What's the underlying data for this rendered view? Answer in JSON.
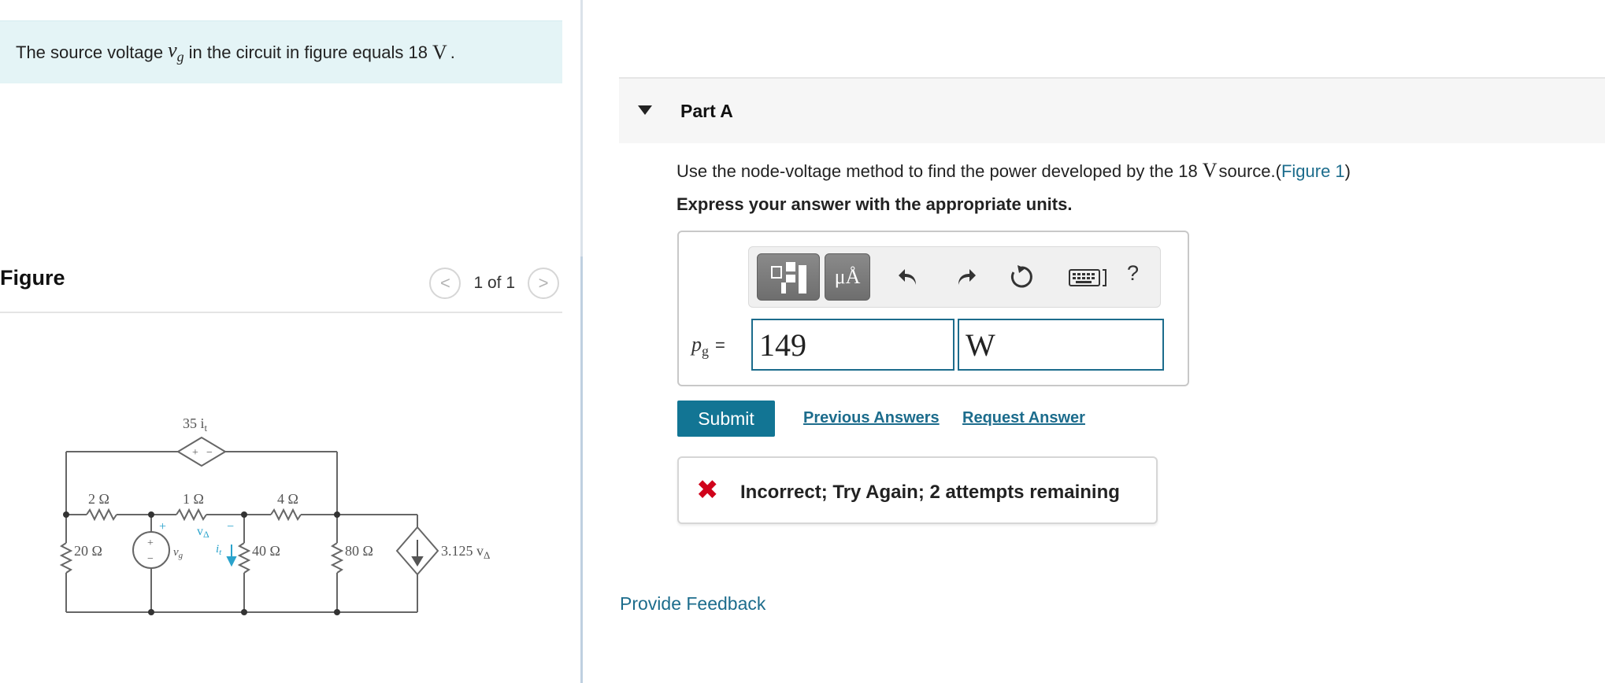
{
  "problem": {
    "text_before": "The source voltage",
    "symbol": "v",
    "symbol_sub": "g",
    "text_after": "in the circuit in figure equals 18",
    "unit": "V",
    "period": "."
  },
  "figure": {
    "title": "Figure",
    "pager": "1 of 1",
    "prev_glyph": "<",
    "next_glyph": ">"
  },
  "circuit": {
    "dep_source_top": "35 i",
    "dep_source_top_sub": "t",
    "r_2": "2 Ω",
    "r_1": "1 Ω",
    "r_4": "4 Ω",
    "v_delta": "v",
    "v_delta_sub": "Δ",
    "r_20": "20 Ω",
    "src": "v",
    "src_sub": "g",
    "i_label": "i",
    "i_sub": "t",
    "r_40": "40 Ω",
    "r_80": "80 Ω",
    "dep_current": "3.125 v",
    "dep_current_sub": "Δ",
    "plus": "+",
    "minus": "−"
  },
  "part": {
    "title": "Part A",
    "question_text": "Use the node-voltage method to find the power developed by the 18",
    "question_unit": "V",
    "question_suffix": "source.(",
    "figure_link": "Figure 1",
    "question_close": ")",
    "instructions": "Express your answer with the appropriate units."
  },
  "toolbar": {
    "units_label": "μÅ",
    "help_label": "?"
  },
  "answer": {
    "variable": "p",
    "variable_sub": "g",
    "equals": "=",
    "value": "149",
    "unit": "W"
  },
  "actions": {
    "submit_label": "Submit",
    "previous_answers": "Previous Answers",
    "request_answer": "Request Answer"
  },
  "feedback": {
    "icon": "✖",
    "message": "Incorrect; Try Again; 2 attempts remaining"
  },
  "footer": {
    "provide_feedback": "Provide Feedback"
  },
  "colors": {
    "accent": "#127594",
    "link": "#1c6c8c",
    "error": "#d0021b",
    "banner_bg": "#e4f4f6",
    "circuit_accent": "#2aa3cc"
  }
}
